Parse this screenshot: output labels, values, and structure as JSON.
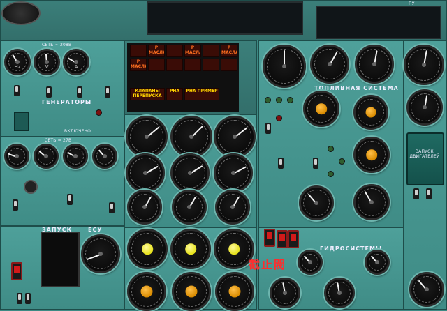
{
  "top": {
    "label_ac_generators": "СЕТЬ ~ 208В",
    "label_generators": "ГЕНЕРАТОРЫ",
    "label_dc_network": "СЕТЬ = 27В",
    "label_connect": "ВКЛЮЧЕНО",
    "label_start": "ЗАПУСК",
    "label_esu": "ЕСУ",
    "label_fuel_system": "ТОПЛИВНАЯ СИСТЕМА",
    "label_hydraulics": "ГИДРОСИСТЕМЫ",
    "label_start_engines": "ЗАПУСК ДВИГАТЕЛЕЙ",
    "label_pump": "ПУ"
  },
  "gauges_ac": [
    {
      "id": "hz",
      "face": "Hz"
    },
    {
      "id": "v",
      "face": "V"
    },
    {
      "id": "a",
      "face": "A"
    }
  ],
  "warning_tiles": {
    "row_labels": [
      "Р МАСЛА",
      "Р МАСЛА",
      "Р МАСЛА",
      "Р МАСЛА"
    ],
    "bottom_left": "КЛАПАНЫ ПЕРЕПУСКА",
    "bottom_mid": "РНА",
    "bottom_right": "РНА ПРИМЕР"
  },
  "gauges_dc": [
    {
      "face": ""
    },
    {
      "face": ""
    },
    {
      "face": ""
    },
    {
      "face": ""
    }
  ],
  "annotation": "截止閥",
  "colors": {
    "panel": "#3d8a84",
    "warning_text": "#ff7020",
    "annotation": "#ff2d2d",
    "knob_orange": "#d98b00",
    "knob_yellow": "#e6e11a"
  }
}
